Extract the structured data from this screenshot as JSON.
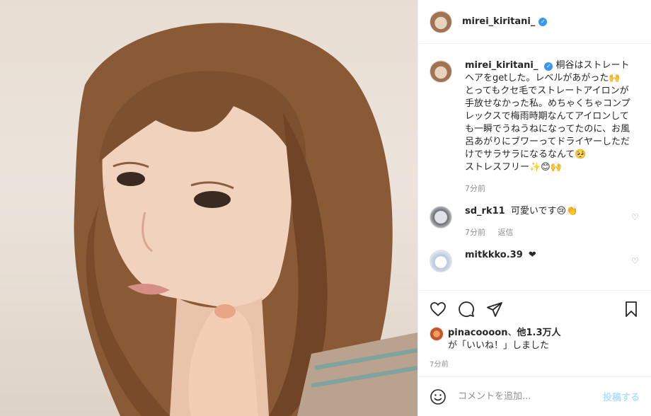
{
  "post": {
    "username": "mirei_kiritani_",
    "verified_icon": "verified-badge-icon",
    "photo_description_icon": "selfie-photo"
  },
  "caption": {
    "username": "mirei_kiritani_",
    "text": "桐谷はストレートヘアをgetした。レベルがあがった🙌\nとってもクセ毛でストレートアイロンが手放せなかった私。めちゃくちゃコンプレックスで梅雨時期なんてアイロンしても一瞬でうねうねになってたのに、お風呂あがりにブワーってドライヤーしただけでサラサラになるなんて🥺\nストレスフリー✨😊🙌",
    "time": "7分前"
  },
  "comments": [
    {
      "username": "sd_rk11",
      "text": "可愛いです😢👏",
      "time": "7分前",
      "reply_label": "返信"
    },
    {
      "username": "mitkkko.39",
      "text": "❤"
    }
  ],
  "likes": {
    "first_liker": "pinacoooon",
    "connector": "、",
    "others": "他1.3万人",
    "suffix": "が「いいね！」しました"
  },
  "timestamp": "7分前",
  "add_comment": {
    "placeholder": "コメントを追加...",
    "post_label": "投稿する"
  },
  "colors": {
    "verified": "#3897f0",
    "post_button_disabled": "#b2dffc",
    "muted_text": "#8e8e8e"
  }
}
